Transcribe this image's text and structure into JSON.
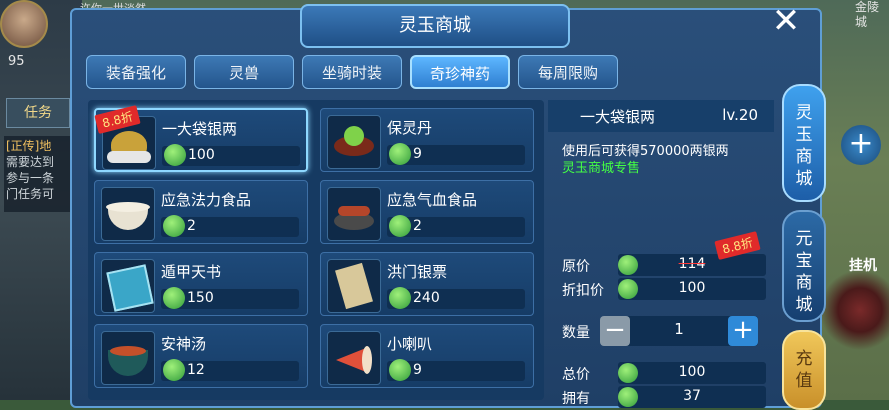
{
  "window": {
    "title": "灵玉商城"
  },
  "background": {
    "top_marquee": "许你一世淡然",
    "player_level": "95",
    "task_tab": "任务",
    "task_tag": "[正传]",
    "task_title": "地",
    "task_lines": [
      "需要达到",
      "参与一条",
      "门任务可"
    ],
    "right_top_1": "金陵",
    "right_top_2": "城",
    "hang_label": "挂机",
    "plus_symbol": "+"
  },
  "tabs": [
    {
      "label": "装备强化",
      "active": false
    },
    {
      "label": "灵兽",
      "active": false
    },
    {
      "label": "坐骑时装",
      "active": false
    },
    {
      "label": "奇珍神药",
      "active": true
    },
    {
      "label": "每周限购",
      "active": false
    }
  ],
  "discount_tag": "8.8折",
  "items": [
    {
      "name": "一大袋银两",
      "price": "100",
      "icon": "silver-bag-icon",
      "selected": true,
      "discount": true
    },
    {
      "name": "保灵丹",
      "price": "9",
      "icon": "pill-icon",
      "selected": false,
      "discount": false
    },
    {
      "name": "应急法力食品",
      "price": "2",
      "icon": "porridge-bowl-icon",
      "selected": false,
      "discount": false
    },
    {
      "name": "应急气血食品",
      "price": "2",
      "icon": "sausage-plate-icon",
      "selected": false,
      "discount": false
    },
    {
      "name": "遁甲天书",
      "price": "150",
      "icon": "book-icon",
      "selected": false,
      "discount": false
    },
    {
      "name": "洪门银票",
      "price": "240",
      "icon": "scroll-icon",
      "selected": false,
      "discount": false
    },
    {
      "name": "安神汤",
      "price": "12",
      "icon": "soup-bowl-icon",
      "selected": false,
      "discount": false
    },
    {
      "name": "小喇叭",
      "price": "9",
      "icon": "horn-icon",
      "selected": false,
      "discount": false
    }
  ],
  "detail": {
    "name": "一大袋银两",
    "level": "lv.20",
    "description": "使用后可获得570000两银两",
    "shop_note": "灵玉商城专售",
    "original_label": "原价",
    "original_price": "114",
    "discount_label": "折扣价",
    "discount_price": "100",
    "quantity_label": "数量",
    "quantity": "1",
    "total_label": "总价",
    "total": "100",
    "owned_label": "拥有",
    "owned": "37",
    "minus": "−",
    "plus": "+"
  },
  "side_buttons": [
    {
      "label": "灵玉商城"
    },
    {
      "label": "元宝商城"
    },
    {
      "label": "充值"
    }
  ],
  "close": "✕"
}
